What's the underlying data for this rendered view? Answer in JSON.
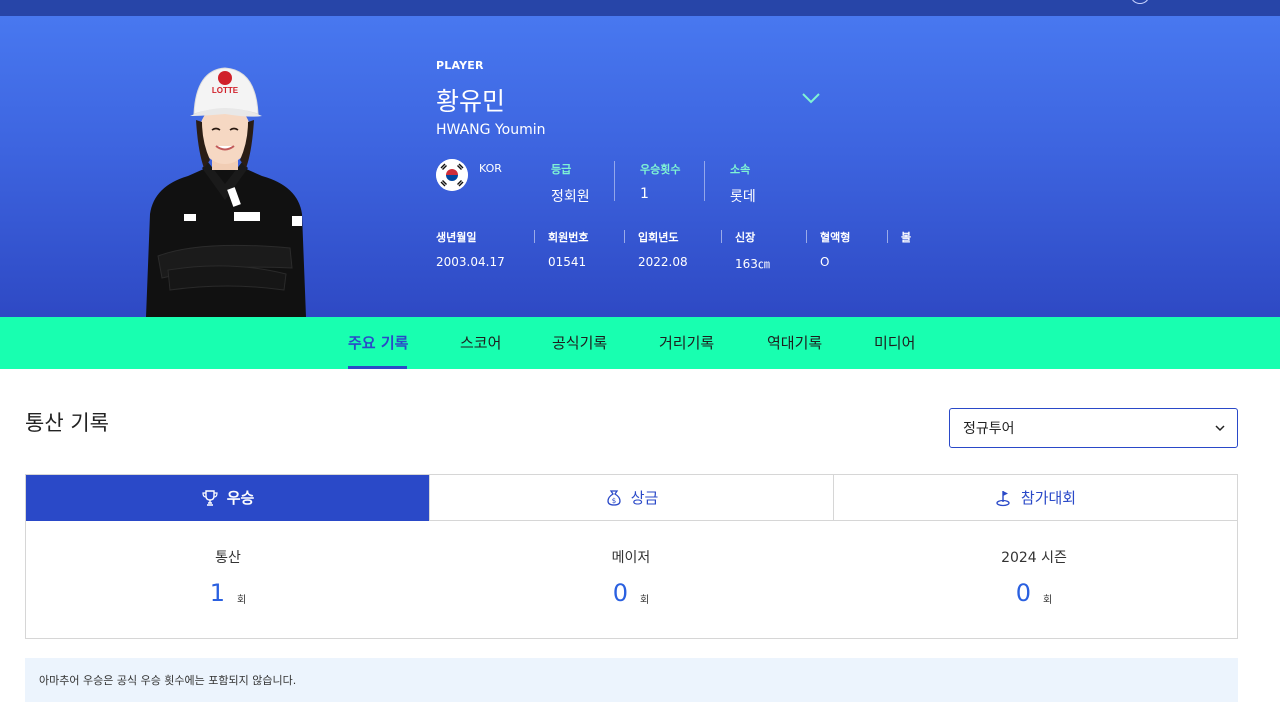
{
  "player": {
    "tag": "PLAYER",
    "name_kr": "황유민",
    "name_en": "HWANG Youmin",
    "nation": "KOR",
    "grade_label": "등급",
    "grade_value": "정회원",
    "wins_label": "우승횟수",
    "wins_value": "1",
    "team_label": "소속",
    "team_value": "롯데",
    "cap_logo_text": "LOTTE"
  },
  "info": [
    {
      "label": "생년월일",
      "value": "2003.04.17"
    },
    {
      "label": "회원번호",
      "value": "01541"
    },
    {
      "label": "입회년도",
      "value": "2022.08"
    },
    {
      "label": "신장",
      "value": "163㎝"
    },
    {
      "label": "혈액형",
      "value": "O"
    },
    {
      "label": "볼",
      "value": ""
    }
  ],
  "tabs": [
    "주요 기록",
    "스코어",
    "공식기록",
    "거리기록",
    "역대기록",
    "미디어"
  ],
  "active_tab": "주요 기록",
  "section": {
    "title": "통산 기록",
    "tour_select": "정규투어"
  },
  "panel_tabs": [
    {
      "label": "우승",
      "icon": "trophy-icon",
      "active": true
    },
    {
      "label": "상금",
      "icon": "money-bag-icon",
      "active": false
    },
    {
      "label": "참가대회",
      "icon": "golf-flag-icon",
      "active": false
    }
  ],
  "stats": [
    {
      "label": "통산",
      "value": "1",
      "unit": "회"
    },
    {
      "label": "메이저",
      "value": "0",
      "unit": "회"
    },
    {
      "label": "2024 시즌",
      "value": "0",
      "unit": "회"
    }
  ],
  "note": "아마추어 우승은 공식 우승 횟수에는 포함되지 않습니다.",
  "colors": {
    "hero_top": "#4878f0",
    "hero_bottom": "#2e49c4",
    "tab_bar": "#18ffb0",
    "accent": "#2a49c8",
    "stat_number": "#2a60e0",
    "label_mint": "#7ff3d4"
  }
}
